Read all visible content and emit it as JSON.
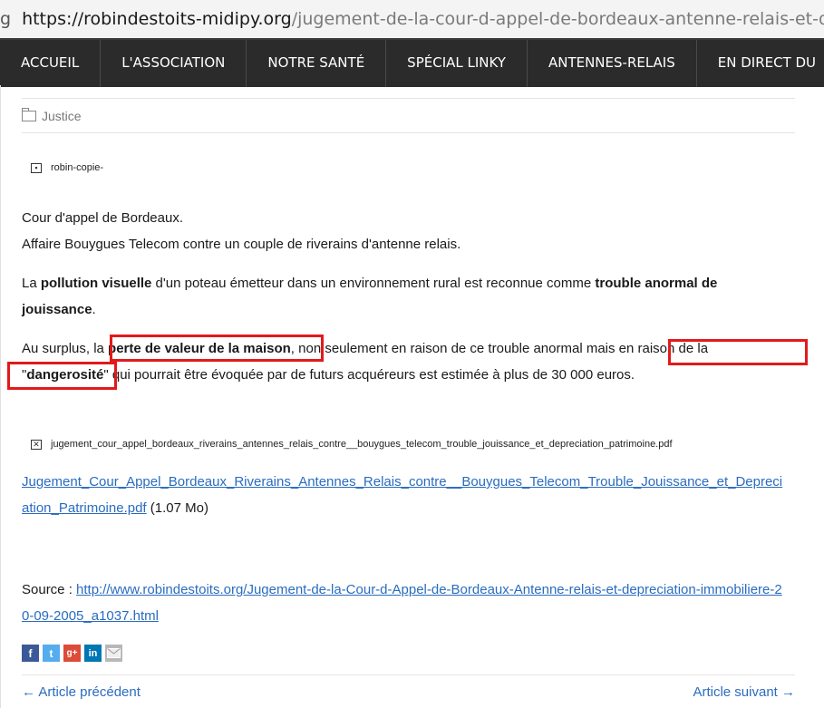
{
  "browser": {
    "lead": "g",
    "url_host": "https://robindestoits-midipy.org",
    "url_path": "/jugement-de-la-cour-d-appel-de-bordeaux-antenne-relais-et-depreciation/"
  },
  "nav": {
    "items": [
      "ACCUEIL",
      "L'ASSOCIATION",
      "NOTRE SANTÉ",
      "SPÉCIAL LINKY",
      "ANTENNES-RELAIS",
      "EN DIRECT DU"
    ]
  },
  "article": {
    "category": "Justice",
    "image1_alt": "robin-copie-",
    "line1": "Cour d'appel de Bordeaux.",
    "line2": "Affaire Bouygues Telecom contre un couple de riverains d'antenne relais.",
    "p2": {
      "t1": "La ",
      "b1": "pollution visuelle",
      "t2": " d'un poteau émetteur dans un environnement rural est reconnue comme ",
      "b2": "trouble anormal de jouissance",
      "t3": "."
    },
    "p3": {
      "t1": "Au surplus, la ",
      "b1": "perte de valeur de la maison",
      "t2": ", non seulement en raison de ce trouble anormal mais en raison de la \"",
      "b2": "dangerosité",
      "t3": "\" qui pourrait être évoquée par de futurs acquéreurs est estimée à plus de 30 000 euros."
    },
    "image2_alt": "jugement_cour_appel_bordeaux_riverains_antennes_relais_contre__bouygues_telecom_trouble_jouissance_et_depreciation_patrimoine.pdf",
    "pdf_link": "Jugement_Cour_Appel_Bordeaux_Riverains_Antennes_Relais_contre__Bouygues_Telecom_Trouble_Jouissance_et_Depreciation_Patrimoine.pdf",
    "pdf_size": "(1.07 Mo)",
    "source_label": "Source : ",
    "source_url": "http://www.robindestoits.org/Jugement-de-la-Cour-d-Appel-de-Bordeaux-Antenne-relais-et-depreciation-immobiliere-20-09-2005_a1037.html"
  },
  "share": {
    "icons": [
      "facebook-icon",
      "twitter-icon",
      "google-plus-icon",
      "linkedin-icon",
      "email-icon"
    ],
    "facebook_glyph": "f",
    "twitter_glyph": "t",
    "gplus_glyph": "g+",
    "linkedin_glyph": "in",
    "colors": {
      "facebook": "#3b5998",
      "twitter": "#55acee",
      "gplus": "#dd4b39",
      "linkedin": "#0077b5",
      "email": "#b8b8b8"
    }
  },
  "pager": {
    "prev": "← Article précédent",
    "next": "Article suivant →"
  },
  "colors": {
    "highlight": "#e21a1a",
    "link": "#2a6cc0",
    "nav_bg": "#2b2b2b"
  }
}
